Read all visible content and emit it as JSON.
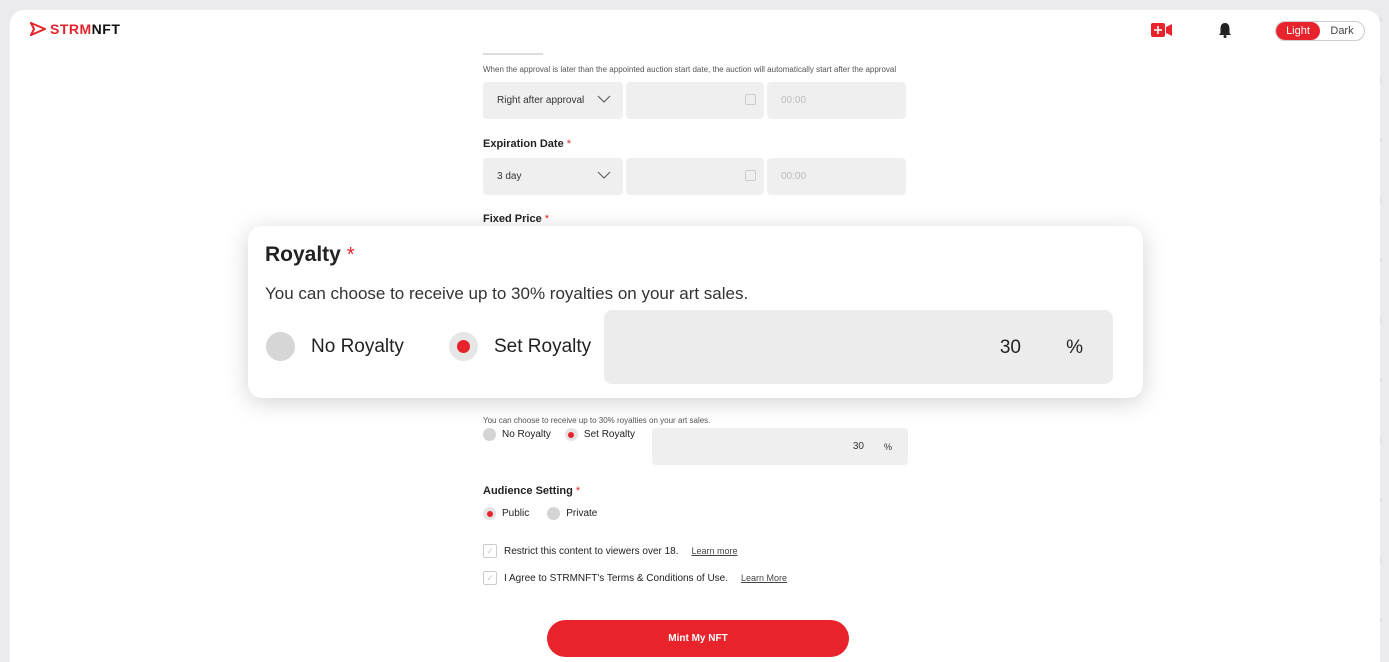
{
  "header": {
    "logo_strm": "STRM",
    "logo_nft": "NFT",
    "theme_light": "Light",
    "theme_dark": "Dark"
  },
  "start": {
    "note": "When the approval is later than the appointed auction start date, the auction will automatically start after the approval",
    "select_value": "Right after approval",
    "time_placeholder": "00:00"
  },
  "expiration": {
    "label": "Expiration Date",
    "select_value": "3 day",
    "time_placeholder": "00:00"
  },
  "fixed_price": {
    "label": "Fixed Price"
  },
  "royalty": {
    "label": "Royalty",
    "description": "You can choose to receive up to 30% royalties on your art sales.",
    "option_none": "No Royalty",
    "option_set": "Set Royalty",
    "value": "30",
    "unit": "%"
  },
  "audience": {
    "label": "Audience Setting",
    "option_public": "Public",
    "option_private": "Private"
  },
  "restrict": {
    "text": "Restrict this content to viewers over 18.",
    "link": "Learn more"
  },
  "agree": {
    "text": "I Agree to STRMNFT's Terms & Conditions of Use.",
    "link": "Learn More"
  },
  "mint_button": "Mint My NFT",
  "required_mark": "*",
  "colors": {
    "accent": "#e8232b"
  }
}
